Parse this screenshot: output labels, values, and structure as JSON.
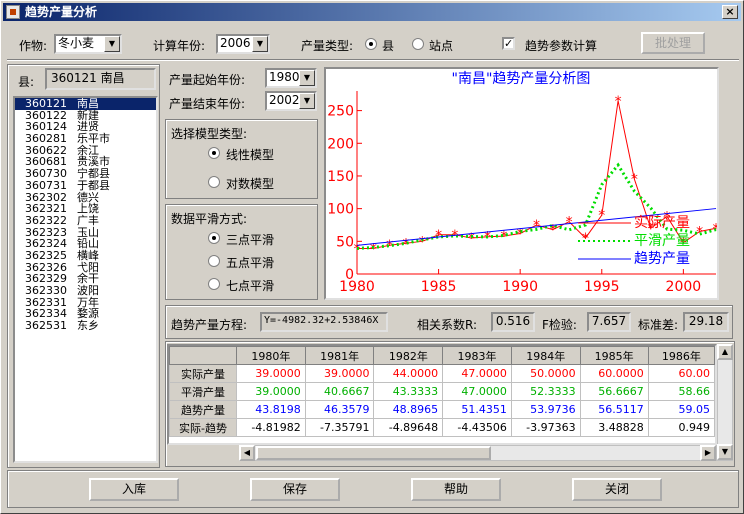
{
  "window": {
    "title": "趋势产量分析",
    "close_glyph": "×"
  },
  "toolbar": {
    "crop_label": "作物:",
    "crop_value": "冬小麦",
    "year_label": "计算年份:",
    "year_value": "2006",
    "type_label": "产量类型:",
    "type_county": "县",
    "type_station": "站点",
    "trend_param_label": "趋势参数计算",
    "trend_param_checked": "✓",
    "batch_label": "批处理"
  },
  "county": {
    "label": "县:",
    "current": "360121 南昌"
  },
  "county_list": [
    {
      "code": "360121",
      "name": "南昌",
      "selected": true
    },
    {
      "code": "360122",
      "name": "新建"
    },
    {
      "code": "360124",
      "name": "进贤"
    },
    {
      "code": "360281",
      "name": "乐平市"
    },
    {
      "code": "360622",
      "name": "余江"
    },
    {
      "code": "360681",
      "name": "贵溪市"
    },
    {
      "code": "360730",
      "name": "宁都县"
    },
    {
      "code": "360731",
      "name": "于都县"
    },
    {
      "code": "362302",
      "name": "德兴"
    },
    {
      "code": "362321",
      "name": "上饶"
    },
    {
      "code": "362322",
      "name": "广丰"
    },
    {
      "code": "362323",
      "name": "玉山"
    },
    {
      "code": "362324",
      "name": "铅山"
    },
    {
      "code": "362325",
      "name": "横峰"
    },
    {
      "code": "362326",
      "name": "弋阳"
    },
    {
      "code": "362329",
      "name": "余干"
    },
    {
      "code": "362330",
      "name": "波阳"
    },
    {
      "code": "362331",
      "name": "万年"
    },
    {
      "code": "362334",
      "name": "婺源"
    },
    {
      "code": "362531",
      "name": "东乡"
    }
  ],
  "params": {
    "start_label": "产量起始年份:",
    "start_value": "1980",
    "end_label": "产量结束年份:",
    "end_value": "2002",
    "model_label": "选择模型类型:",
    "model_linear": "线性模型",
    "model_log": "对数模型",
    "smooth_label": "数据平滑方式:",
    "smooth_3": "三点平滑",
    "smooth_5": "五点平滑",
    "smooth_7": "七点平滑"
  },
  "chart_data": {
    "type": "line",
    "title": "\"南昌\"趋势产量分析图",
    "x_ticks": [
      1980,
      1985,
      1990,
      1995,
      2000
    ],
    "y_ticks": [
      0,
      50,
      100,
      150,
      200,
      250
    ],
    "xlim": [
      1980,
      2002
    ],
    "ylim": [
      0,
      280
    ],
    "legend_position": "right",
    "grid": false,
    "series": [
      {
        "name": "实际产量",
        "color": "#ff0000",
        "style": "solid-star",
        "x": [
          1980,
          1981,
          1982,
          1983,
          1984,
          1985,
          1986,
          1987,
          1988,
          1989,
          1990,
          1991,
          1992,
          1993,
          1994,
          1995,
          1996,
          1997,
          1998,
          1999,
          2000,
          2001,
          2002
        ],
        "y": [
          39,
          39,
          44,
          47,
          50,
          60,
          60,
          55,
          57,
          58,
          62,
          75,
          68,
          80,
          55,
          90,
          265,
          145,
          70,
          88,
          48,
          65,
          70
        ]
      },
      {
        "name": "平滑产量",
        "color": "#00dd00",
        "style": "dotted",
        "x": [
          1980,
          1981,
          1982,
          1983,
          1984,
          1985,
          1986,
          1987,
          1988,
          1989,
          1990,
          1991,
          1992,
          1993,
          1994,
          1995,
          1996,
          1997,
          1998,
          1999,
          2000,
          2001,
          2002
        ],
        "y": [
          39,
          40.67,
          43.33,
          47,
          52.33,
          56.67,
          58.3,
          57.3,
          56.7,
          59,
          65,
          68.3,
          74.3,
          67.7,
          75,
          136.7,
          166.7,
          126.7,
          101,
          68.7,
          67,
          61,
          68
        ]
      },
      {
        "name": "趋势产量",
        "color": "#0000ff",
        "style": "solid",
        "x": [
          1980,
          2002
        ],
        "y": [
          43.82,
          100.12
        ]
      }
    ]
  },
  "equation": {
    "label": "趋势产量方程:",
    "value": "Y=-4982.32+2.53846X",
    "r_label": "相关系数R:",
    "r_value": "0.516",
    "f_label": "F检验:",
    "f_value": "7.657",
    "sd_label": "标准差:",
    "sd_value": "29.18"
  },
  "table": {
    "headers": [
      "1980年",
      "1981年",
      "1982年",
      "1983年",
      "1984年",
      "1985年",
      "1986年"
    ],
    "rows": [
      {
        "label": "实际产量",
        "color": "#ff0000",
        "values": [
          "39.0000",
          "39.0000",
          "44.0000",
          "47.0000",
          "50.0000",
          "60.0000",
          "60.00"
        ]
      },
      {
        "label": "平滑产量",
        "color": "#00b000",
        "values": [
          "39.0000",
          "40.6667",
          "43.3333",
          "47.0000",
          "52.3333",
          "56.6667",
          "58.66"
        ]
      },
      {
        "label": "趋势产量",
        "color": "#0000ff",
        "values": [
          "43.8198",
          "46.3579",
          "48.8965",
          "51.4351",
          "53.9736",
          "56.5117",
          "59.05"
        ]
      },
      {
        "label": "实际-趋势",
        "color": "#000000",
        "values": [
          "-4.81982",
          "-7.35791",
          "-4.89648",
          "-4.43506",
          "-3.97363",
          "3.48828",
          "0.949"
        ]
      }
    ]
  },
  "buttons": {
    "save_db": "入库",
    "save": "保存",
    "help": "帮助",
    "close": "关闭"
  }
}
